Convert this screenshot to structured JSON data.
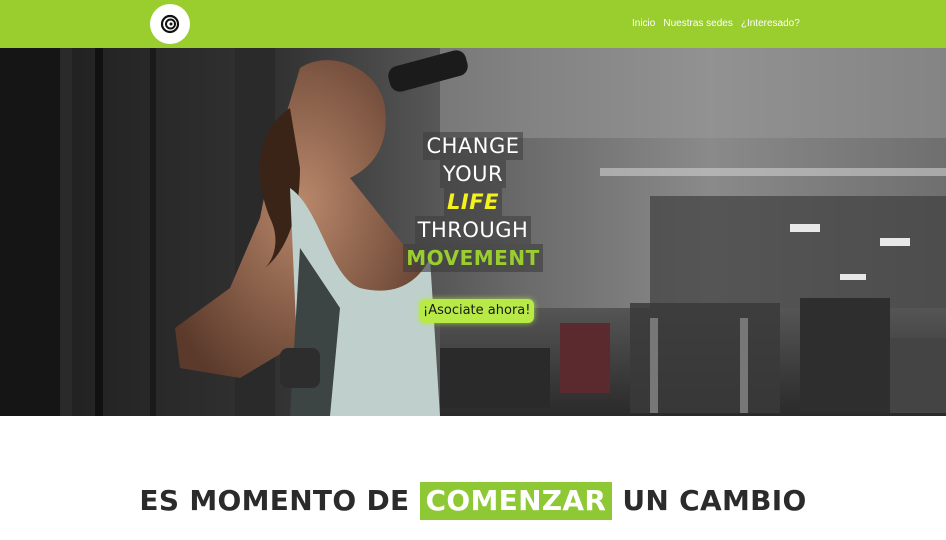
{
  "nav": {
    "logo_icon": "spiral-logo-icon",
    "links": [
      "Inicio",
      "Nuestras sedes",
      "¿Interesado?"
    ]
  },
  "hero": {
    "line1": "CHANGE",
    "line2": "YOUR",
    "line3": "LIFE",
    "line4": "THROUGH",
    "line5": "MOVEMENT",
    "cta_label": "¡Asociate ahora!"
  },
  "section": {
    "heading_before": "ES MOMENTO DE",
    "heading_highlight": "COMENZAR",
    "heading_after": "UN CAMBIO"
  },
  "colors": {
    "brand_green": "#9acd2e",
    "accent_yellow": "#f4f21c",
    "cta_green": "#b8ea47"
  }
}
